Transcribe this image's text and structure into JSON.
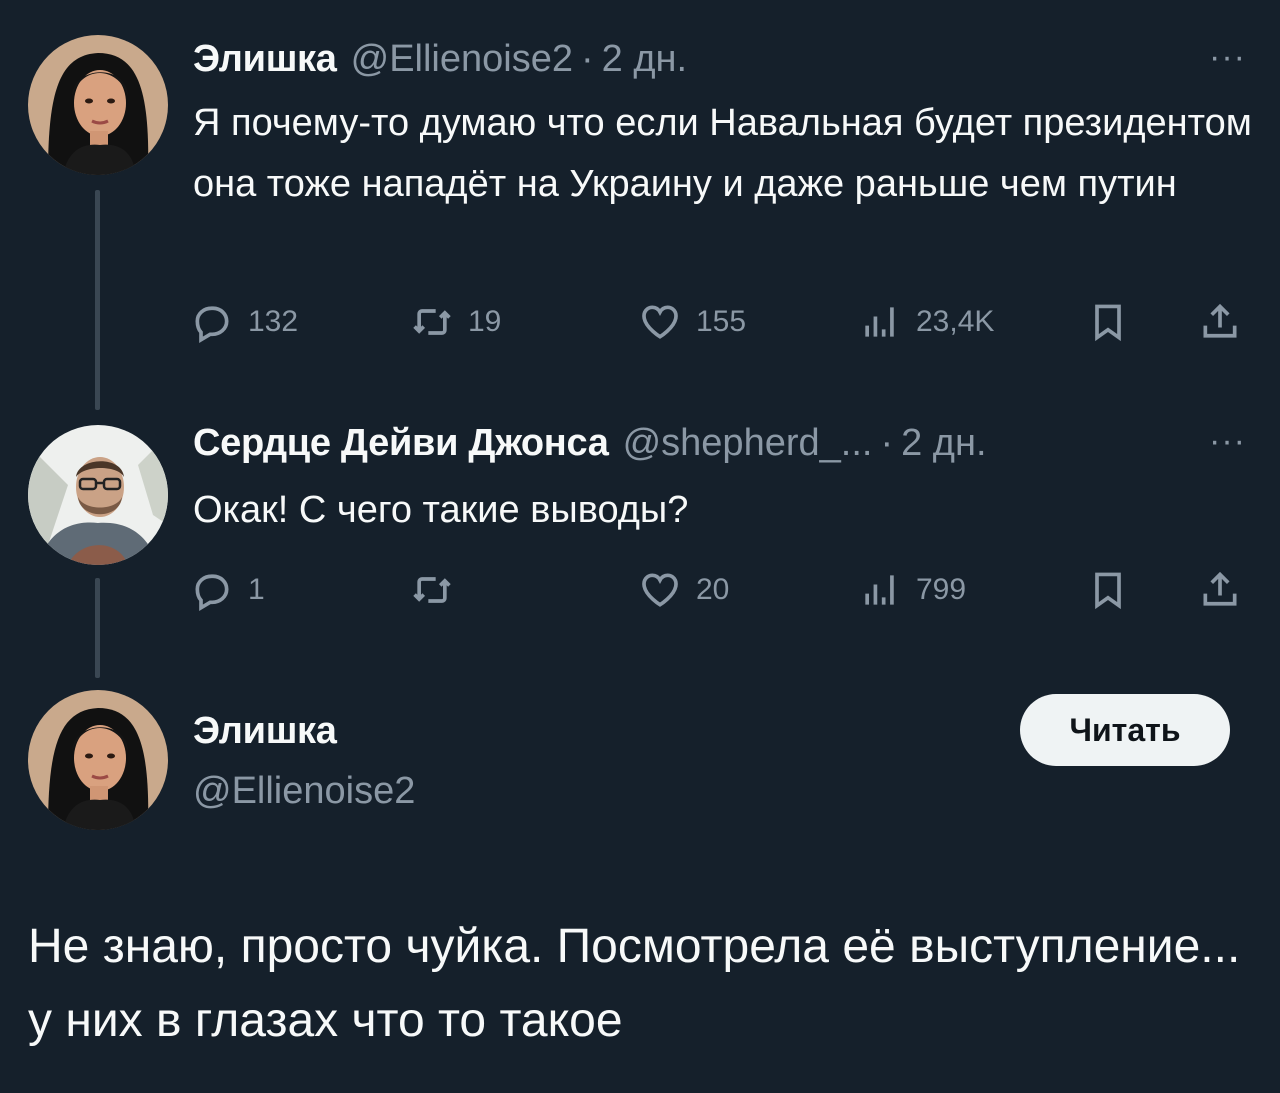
{
  "tweets": [
    {
      "name": "Элишка",
      "handle": "@Ellienoise2",
      "sep": "·",
      "time": "2 дн.",
      "more": "···",
      "text": "Я почему-то думаю что если Навальная будет президентом она тоже нападёт на Украину и даже раньше чем путин",
      "replies": "132",
      "retweets": "19",
      "likes": "155",
      "views": "23,4K"
    },
    {
      "name": "Сердце Дейви Джонса",
      "handle": "@shepherd_...",
      "sep": "·",
      "time": "2 дн.",
      "more": "···",
      "text": "Окак! С чего такие выводы?",
      "replies": "1",
      "retweets": "",
      "likes": "20",
      "views": "799"
    }
  ],
  "main": {
    "name": "Элишка",
    "handle": "@Ellienoise2",
    "follow_label": "Читать",
    "text": "Не знаю, просто чуйка. Посмотрела её выступление... у них в глазах что то такое"
  },
  "icons": [
    "reply-icon",
    "retweet-icon",
    "like-icon",
    "views-icon",
    "bookmark-icon",
    "share-icon"
  ],
  "colors": {
    "background": "#15202b",
    "text": "#f7f9f9",
    "muted": "#8b98a5",
    "button": "#eff3f4"
  }
}
